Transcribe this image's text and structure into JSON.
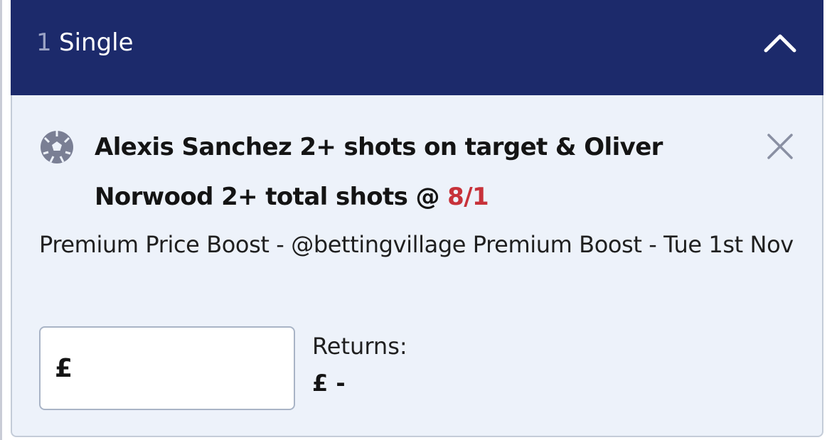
{
  "header": {
    "count": "1",
    "title": "Single",
    "collapse_icon": "chevron-up-icon"
  },
  "bet": {
    "sport_icon": "football-icon",
    "selection_text": "Alexis Sanchez 2+ shots on target & Oliver Norwood 2+ total shots @ ",
    "odds": "8/1",
    "close_icon": "close-icon",
    "market": "Premium Price Boost - @bettingvillage Premium Boost - Tue 1st Nov"
  },
  "stake": {
    "currency": "£",
    "value": "",
    "placeholder": ""
  },
  "returns": {
    "label": "Returns:",
    "value": "£ -"
  },
  "colors": {
    "header_bg": "#1c2a6b",
    "card_bg": "#edf2fa",
    "odds": "#c7323a"
  }
}
